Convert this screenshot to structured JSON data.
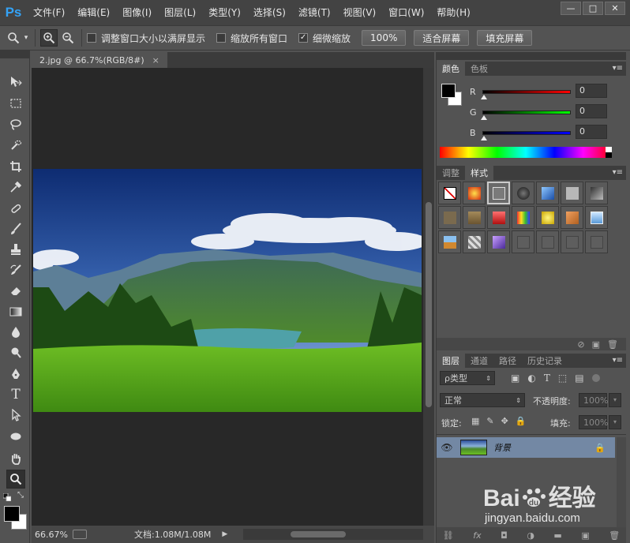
{
  "app": {
    "logo": "Ps"
  },
  "menu": [
    "文件(F)",
    "编辑(E)",
    "图像(I)",
    "图层(L)",
    "类型(Y)",
    "选择(S)",
    "滤镜(T)",
    "视图(V)",
    "窗口(W)",
    "帮助(H)"
  ],
  "window_controls": {
    "minimize": "—",
    "maximize": "□",
    "close": "✕"
  },
  "options": {
    "resize_windows": {
      "label": "调整窗口大小以满屏显示",
      "checked": false
    },
    "zoom_all": {
      "label": "缩放所有窗口",
      "checked": false
    },
    "scrubby_zoom": {
      "label": "细微缩放",
      "checked": true
    },
    "btn_100": "100%",
    "btn_fit": "适合屏幕",
    "btn_fill": "填充屏幕"
  },
  "document": {
    "tab_title": "2.jpg @ 66.7%(RGB/8#)",
    "tab_close": "×",
    "zoom_readout": "66.67%",
    "doc_info": "文档:1.08M/1.08M"
  },
  "color_panel": {
    "tabs": [
      "颜色",
      "色板"
    ],
    "active_tab": "颜色",
    "channels": [
      {
        "label": "R",
        "value": "0",
        "color": "#ff0000"
      },
      {
        "label": "G",
        "value": "0",
        "color": "#00ff00"
      },
      {
        "label": "B",
        "value": "0",
        "color": "#0000ff"
      }
    ]
  },
  "styles_panel": {
    "tabs": [
      "调整",
      "样式"
    ],
    "active_tab": "样式",
    "swatch_count": 21
  },
  "layers_panel": {
    "tabs": [
      "图层",
      "通道",
      "路径",
      "历史记录"
    ],
    "active_tab": "图层",
    "filter_label": "ρ类型",
    "blend_mode": "正常",
    "opacity_label": "不透明度:",
    "opacity_value": "100%",
    "lock_label": "锁定:",
    "fill_label": "填充:",
    "fill_value": "100%",
    "layers": [
      {
        "name": "背景",
        "locked": true,
        "visible": true
      }
    ]
  },
  "watermark": {
    "brand": "Bai",
    "brand2": "经验",
    "url": "jingyan.baidu.com"
  }
}
